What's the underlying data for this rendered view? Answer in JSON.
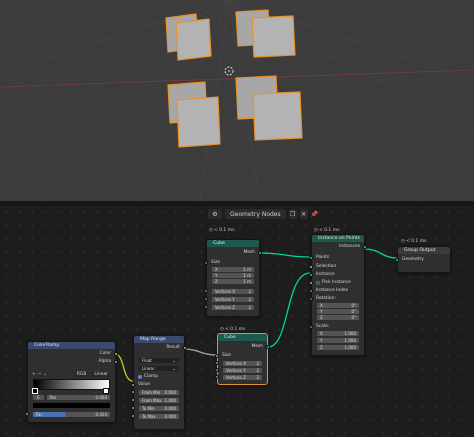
{
  "editor": {
    "title": "Geometry Nodes",
    "editor_icon": "geometry-nodes-editor-icon",
    "controls": [
      "copy-icon",
      "close-icon",
      "pin-icon"
    ]
  },
  "nodes": {
    "cube_a": {
      "timer": "< 0.1 ms",
      "title": "Cube",
      "output": "Mesh",
      "size_label": "Size",
      "x_label": "X",
      "x_val": "1 m",
      "y_label": "Y",
      "y_val": "1 m",
      "z_label": "Z",
      "z_val": "1 m",
      "vx_label": "Vertices X",
      "vx_val": "2",
      "vy_label": "Vertices Y",
      "vy_val": "2",
      "vz_label": "Vertices Z",
      "vz_val": "2"
    },
    "instance": {
      "timer": "< 0.1 ms",
      "title": "Instance on Points",
      "output": "Instances",
      "points": "Points",
      "selection": "Selection",
      "instance": "Instance",
      "pick_instance": "Pick Instance",
      "instance_index": "Instance Index",
      "rotation": "Rotation:",
      "rx_label": "X",
      "rx_val": "0°",
      "ry_label": "Y",
      "ry_val": "0°",
      "rz_label": "Z",
      "rz_val": "0°",
      "scale": "Scale:",
      "sx_label": "X",
      "sx_val": "1.000",
      "sy_label": "Y",
      "sy_val": "1.000",
      "sz_label": "Z",
      "sz_val": "1.000"
    },
    "group_output": {
      "timer": "< 0.1 ms",
      "title": "Group Output",
      "geometry": "Geometry"
    },
    "colorramp": {
      "title": "ColorRamp",
      "color_out": "Color",
      "alpha_out": "Alpha",
      "add": "+",
      "remove": "−",
      "menu": "⌄",
      "color_mode": "RGB",
      "interp": "Linear",
      "stop_index": "0",
      "pos_label": "Pos",
      "pos_val": "0.000",
      "fac_label": "Fac",
      "fac_val": "0.424"
    },
    "map_range": {
      "title": "Map Range",
      "result": "Result",
      "data_type": "Float",
      "interp": "Linear",
      "clamp": "Clamp",
      "value": "Value",
      "from_min_label": "From Min",
      "from_min_val": "0.000",
      "from_max_label": "From Max",
      "from_max_val": "1.000",
      "to_min_label": "To Min",
      "to_min_val": "0.000",
      "to_max_label": "To Max",
      "to_max_val": "0.000"
    },
    "cube_b": {
      "timer": "< 0.1 ms",
      "title": "Cube",
      "output": "Mesh",
      "size_label": "Size",
      "vx_label": "Vertices X",
      "vx_val": "2",
      "vy_label": "Vertices Y",
      "vy_val": "2",
      "vz_label": "Vertices Z",
      "vz_val": "2"
    }
  },
  "colors": {
    "geometry_socket": "#00d6a3",
    "selection_outline": "#e6932b",
    "viewport_bg": "#3c3c3c",
    "editor_bg": "#1d1d1d",
    "geometry_header": "#1c5a4e",
    "converter_header": "#3a4a6e"
  }
}
